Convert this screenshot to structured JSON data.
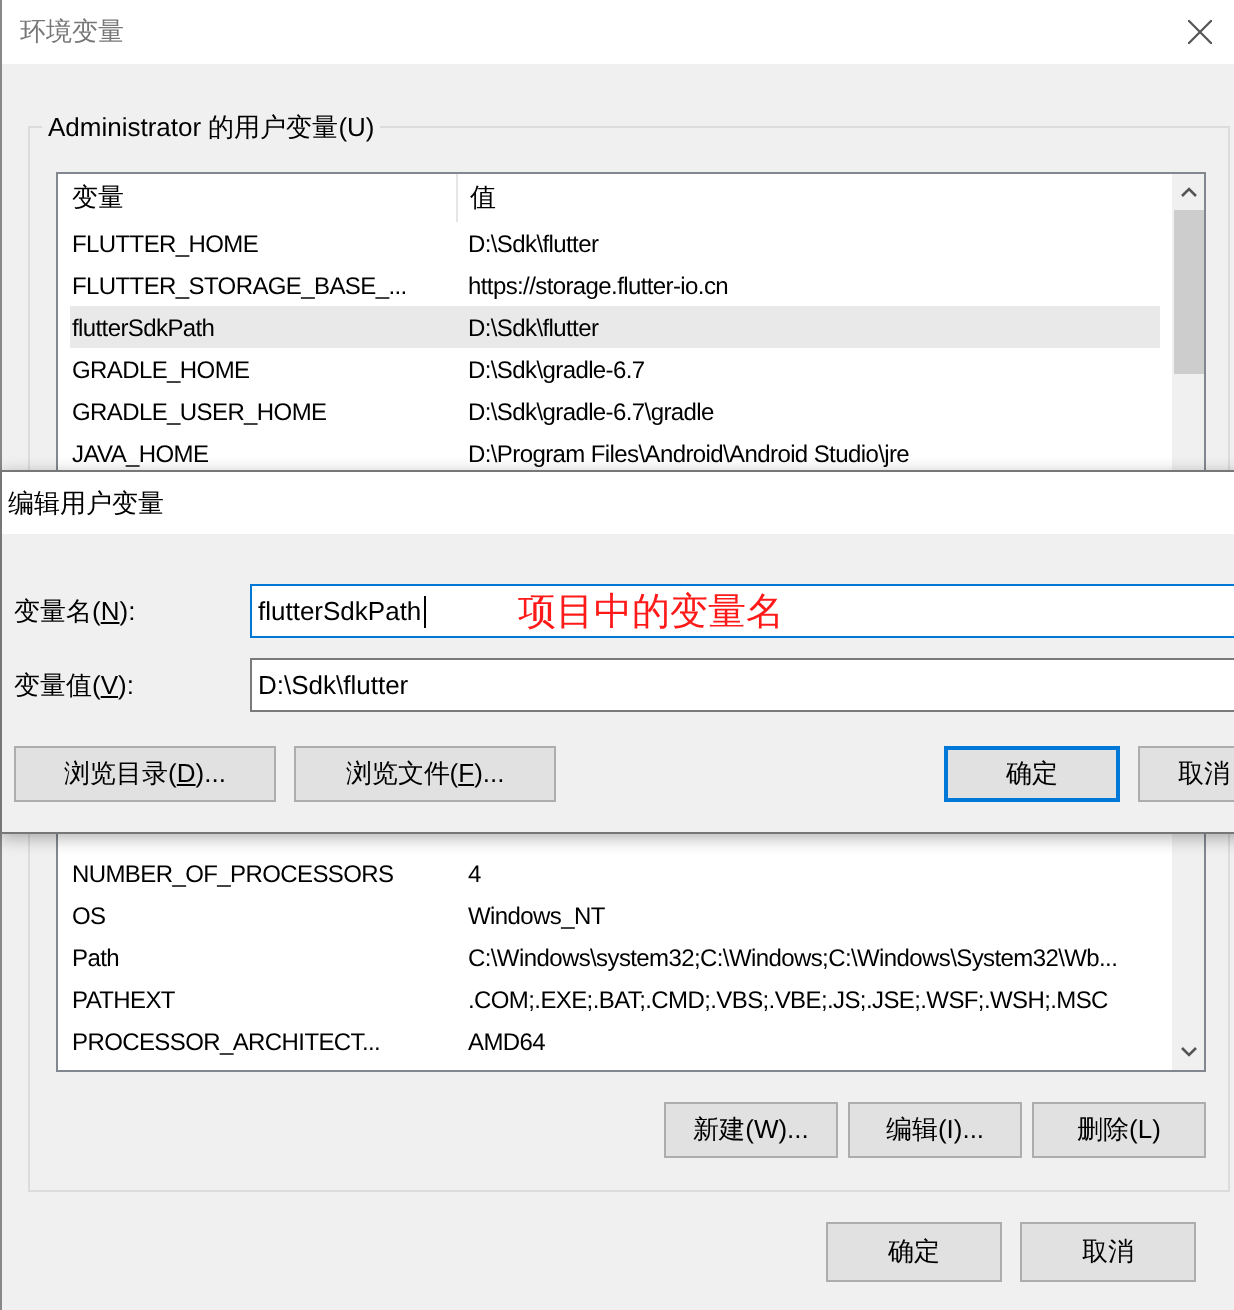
{
  "main_window": {
    "title": "环境变量",
    "group_title": "Administrator 的用户变量(U)",
    "columns": [
      "变量",
      "值"
    ],
    "rows_top": [
      {
        "name": "FLUTTER_HOME",
        "value": "D:\\Sdk\\flutter",
        "selected": false
      },
      {
        "name": "FLUTTER_STORAGE_BASE_...",
        "value": "https://storage.flutter-io.cn",
        "selected": false
      },
      {
        "name": "flutterSdkPath",
        "value": "D:\\Sdk\\flutter",
        "selected": true
      },
      {
        "name": "GRADLE_HOME",
        "value": "D:\\Sdk\\gradle-6.7",
        "selected": false
      },
      {
        "name": "GRADLE_USER_HOME",
        "value": "D:\\Sdk\\gradle-6.7\\gradle",
        "selected": false
      },
      {
        "name": "JAVA_HOME",
        "value": "D:\\Program Files\\Android\\Android Studio\\jre",
        "selected": false
      }
    ],
    "rows_bottom": [
      {
        "name": "NUMBER_OF_PROCESSORS",
        "value": "4",
        "selected": false
      },
      {
        "name": "OS",
        "value": "Windows_NT",
        "selected": false
      },
      {
        "name": "Path",
        "value": "C:\\Windows\\system32;C:\\Windows;C:\\Windows\\System32\\Wb...",
        "selected": false
      },
      {
        "name": "PATHEXT",
        "value": ".COM;.EXE;.BAT;.CMD;.VBS;.VBE;.JS;.JSE;.WSF;.WSH;.MSC",
        "selected": false
      },
      {
        "name": "PROCESSOR_ARCHITECT...",
        "value": "AMD64",
        "selected": false
      }
    ],
    "buttons": [
      "新建(W)...",
      "编辑(I)...",
      "删除(L)"
    ],
    "footer_buttons": [
      "确定",
      "取消"
    ]
  },
  "edit_dialog": {
    "title": "编辑用户变量",
    "fields": [
      {
        "label_before": "变量名(",
        "access_key": "N",
        "label_after": "):",
        "value": "flutterSdkPath",
        "focused": true
      },
      {
        "label_before": "变量值(",
        "access_key": "V",
        "label_after": "):",
        "value": "D:\\Sdk\\flutter",
        "focused": false
      }
    ],
    "browse_buttons": [
      {
        "label_before": "浏览目录(",
        "access_key": "D",
        "label_after": ")..."
      },
      {
        "label_before": "浏览文件(",
        "access_key": "F",
        "label_after": ")..."
      }
    ],
    "buttons": [
      {
        "label": "确定",
        "default": true
      },
      {
        "label": "取消",
        "default": false
      }
    ]
  },
  "annotation": "项目中的变量名"
}
